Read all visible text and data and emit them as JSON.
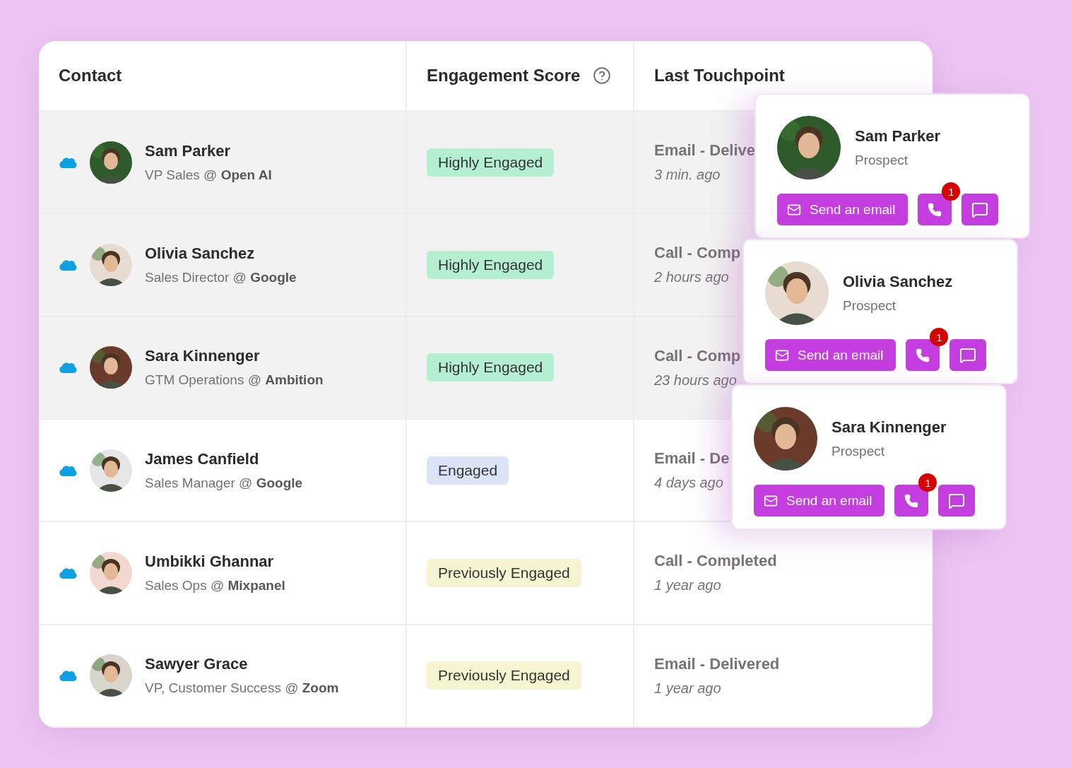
{
  "table": {
    "columns": [
      {
        "label": "Contact",
        "help": false
      },
      {
        "label": "Engagement Score",
        "help": true
      },
      {
        "label": "Last Touchpoint",
        "help": false
      }
    ],
    "rows": [
      {
        "name": "Sam Parker",
        "title": "VP Sales @ **Open AI**",
        "score": "Highly Engaged",
        "color": "#b4efd2",
        "touchpoint": "Email - Delive",
        "when": "3 min. ago",
        "highlighted": true
      },
      {
        "name": "Olivia Sanchez",
        "title": "Sales Director @ **Google**",
        "score": "Highly Engaged",
        "color": "#b4efd2",
        "touchpoint": "Call - Comp",
        "when": "2 hours ago",
        "highlighted": true
      },
      {
        "name": "Sara Kinnenger",
        "title": "GTM Operations @ **Ambition**",
        "score": "Highly Engaged",
        "color": "#b4efd2",
        "touchpoint": "Call - Comp",
        "when": "23 hours ago",
        "highlighted": true
      },
      {
        "name": "James Canfield",
        "title": "Sales Manager @ **Google**",
        "score": "Engaged",
        "color": "#dbe4f6",
        "touchpoint": "Email - De",
        "when": "4 days ago",
        "highlighted": false
      },
      {
        "name": "Umbikki Ghannar",
        "title": "Sales Ops @ **Mixpanel**",
        "score": "Previously Engaged",
        "color": "#f6f3d0",
        "touchpoint": "Call - Completed",
        "when": "1 year ago",
        "highlighted": false
      },
      {
        "name": "Sawyer Grace",
        "title": "VP, Customer Success @ **Zoom**",
        "score": "Previously Engaged",
        "color": "#f6f3d0",
        "touchpoint": "Email - Delivered",
        "when": "1 year ago",
        "highlighted": false
      }
    ]
  },
  "cards": [
    {
      "name": "Sam Parker",
      "role": "Prospect",
      "email_button": "Send an email",
      "call_badge": "1"
    },
    {
      "name": "Olivia Sanchez",
      "role": "Prospect",
      "email_button": "Send an email",
      "call_badge": "1"
    },
    {
      "name": "Sara Kinnenger",
      "role": "Prospect",
      "email_button": "Send an email",
      "call_badge": "1"
    }
  ]
}
